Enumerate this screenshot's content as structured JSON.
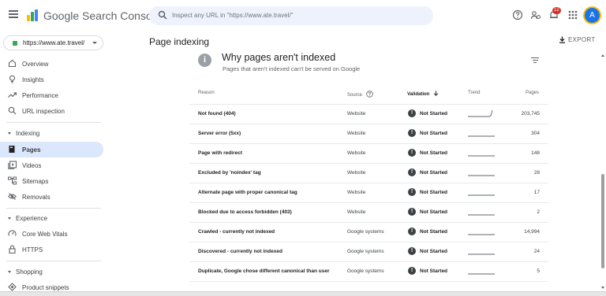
{
  "header": {
    "brand": "Google Search Console",
    "search_placeholder": "Inspect any URL in \"https://www.ate.travel/\"",
    "notification_count": "12",
    "avatar_letter": "A"
  },
  "property": {
    "label": "https://www.ate.travel/"
  },
  "page": {
    "title": "Page indexing",
    "export_label": "EXPORT"
  },
  "sidebar": {
    "overview": "Overview",
    "insights": "Insights",
    "performance": "Performance",
    "url_inspection": "URL inspection",
    "indexing_section": "Indexing",
    "pages": "Pages",
    "videos": "Videos",
    "sitemaps": "Sitemaps",
    "removals": "Removals",
    "experience_section": "Experience",
    "core_web_vitals": "Core Web Vitals",
    "https": "HTTPS",
    "shopping_section": "Shopping",
    "product_snippets": "Product snippets"
  },
  "card": {
    "title": "Why pages aren't indexed",
    "subtitle": "Pages that aren't indexed can't be served on Google",
    "info_glyph": "i"
  },
  "table": {
    "headers": {
      "reason": "Reason",
      "source": "Source",
      "validation": "Validation",
      "trend": "Trend",
      "pages": "Pages"
    },
    "status_glyph": "!",
    "rows": [
      {
        "reason": "Not found (404)",
        "source": "Website",
        "validation": "Not Started",
        "pages": "203,745",
        "trend": "up"
      },
      {
        "reason": "Server error (5xx)",
        "source": "Website",
        "validation": "Not Started",
        "pages": "304",
        "trend": "flat"
      },
      {
        "reason": "Page with redirect",
        "source": "Website",
        "validation": "Not Started",
        "pages": "148",
        "trend": "flat"
      },
      {
        "reason": "Excluded by 'noindex' tag",
        "source": "Website",
        "validation": "Not Started",
        "pages": "28",
        "trend": "flat"
      },
      {
        "reason": "Alternate page with proper canonical tag",
        "source": "Website",
        "validation": "Not Started",
        "pages": "17",
        "trend": "flat"
      },
      {
        "reason": "Blocked due to access forbidden (403)",
        "source": "Website",
        "validation": "Not Started",
        "pages": "2",
        "trend": "flat"
      },
      {
        "reason": "Crawled - currently not indexed",
        "source": "Google systems",
        "validation": "Not Started",
        "pages": "14,994",
        "trend": "flat"
      },
      {
        "reason": "Discovered - currently not indexed",
        "source": "Google systems",
        "validation": "Not Started",
        "pages": "24",
        "trend": "flat"
      },
      {
        "reason": "Duplicate, Google chose different canonical than user",
        "source": "Google systems",
        "validation": "Not Started",
        "pages": "5",
        "trend": "flat"
      }
    ]
  },
  "colors": {
    "accent": "#1a73e8",
    "active_bg": "#dbe7fc",
    "notification": "#d93025"
  }
}
